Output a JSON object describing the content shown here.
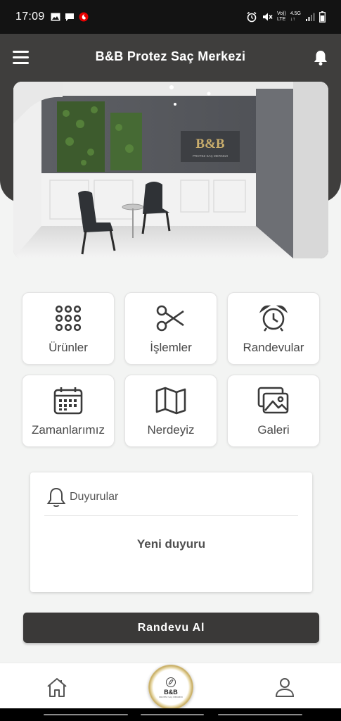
{
  "status_bar": {
    "time": "17:09",
    "network_top": "Vo))",
    "network_bottom": "LTE",
    "network_gen": "4.5G"
  },
  "header": {
    "title": "B&B Protez Saç Merkezi"
  },
  "hero": {
    "sign_text": "B&B",
    "sign_sub": "PROTEZ SAÇ MERKEZI"
  },
  "menu_tiles": [
    {
      "label": "Ürünler",
      "icon": "grid-dots-icon"
    },
    {
      "label": "İşlemler",
      "icon": "scissors-icon"
    },
    {
      "label": "Randevular",
      "icon": "alarm-clock-icon"
    },
    {
      "label": "Zamanlarımız",
      "icon": "calendar-icon"
    },
    {
      "label": "Nerdeyiz",
      "icon": "map-icon"
    },
    {
      "label": "Galeri",
      "icon": "gallery-icon"
    }
  ],
  "announcements": {
    "title": "Duyurular",
    "text": "Yeni duyuru"
  },
  "cta": {
    "label": "Randevu Al"
  },
  "bottom_nav": {
    "logo_text": "B&B",
    "logo_sub": "PROTEZ SAÇ MERKEZI"
  },
  "colors": {
    "header_bg": "#3f3e3d",
    "page_bg": "#f3f4f3",
    "cta_bg": "#3a3938",
    "logo_gold": "#c7ad64"
  }
}
